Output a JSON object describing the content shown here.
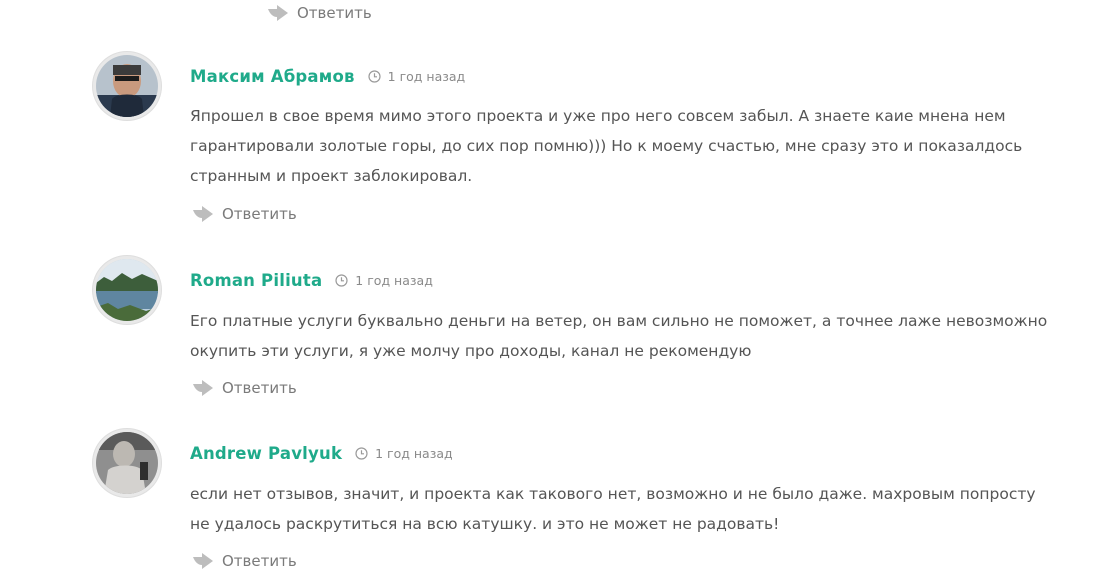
{
  "top_reply": {
    "label": "Ответить"
  },
  "comments": [
    {
      "author": "Максим Абрамов",
      "time": "1 год назад",
      "text": "Япрошел в свое время мимо этого проекта и уже про него совсем забыл. А знаете каие мнена нем гарантировали золотые горы, до сих пор помню))) Но к моему счастью, мне сразу это и показалдось странным и проект заблокировал.",
      "reply_label": "Ответить"
    },
    {
      "author": "Roman Piliuta",
      "time": "1 год назад",
      "text": "Его платные услуги буквально деньги на ветер, он вам сильно не поможет, а точнее лаже невозможно окупить эти услуги, я уже молчу про доходы, канал не рекомендую",
      "reply_label": "Ответить"
    },
    {
      "author": "Andrew Pavlyuk",
      "time": "1 год назад",
      "text": "если нет отзывов, значит, и проекта как такового нет, возможно и не было даже. махровым попросту не удалось раскрутиться на всю катушку. и это не может не радовать!",
      "reply_label": "Ответить"
    }
  ],
  "icons": {
    "reply": "reply-arrow-icon",
    "clock": "clock-icon"
  },
  "colors": {
    "author": "#1faa8a",
    "text": "#555555",
    "meta": "#8a8a8a",
    "reply": "#7a7a7a",
    "reply_icon": "#bdbdbd"
  }
}
